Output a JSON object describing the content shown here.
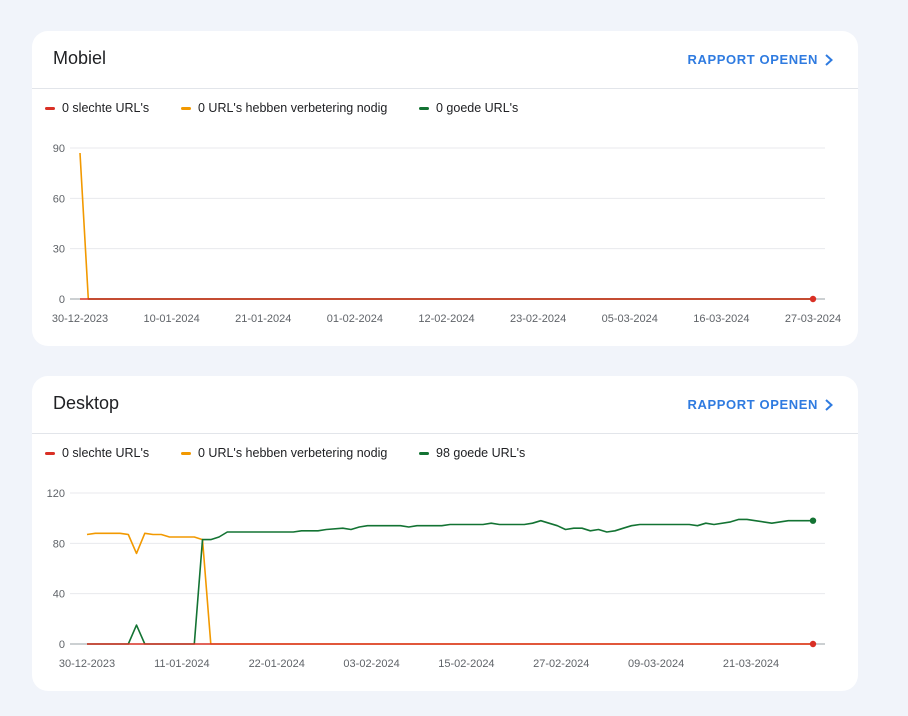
{
  "colors": {
    "poor": "#d93025",
    "needs": "#f29900",
    "good": "#137333",
    "link": "#2f7be0"
  },
  "cards": [
    {
      "title": "Mobiel",
      "link_label": "RAPPORT OPENEN",
      "legend": [
        "0 slechte URL's",
        "0 URL's hebben verbetering nodig",
        "0 goede URL's"
      ],
      "chart_data": {
        "type": "line",
        "x_ticks": [
          "30-12-2023",
          "10-01-2024",
          "21-01-2024",
          "01-02-2024",
          "12-02-2024",
          "23-02-2024",
          "05-03-2024",
          "16-03-2024",
          "27-03-2024"
        ],
        "y_ticks": [
          0,
          30,
          60,
          90
        ],
        "ylim": [
          0,
          90
        ],
        "xlim": [
          0,
          88
        ],
        "grid": true,
        "series": [
          {
            "name": "0 URL's hebben verbetering nodig",
            "color": "#f29900",
            "points": [
              [
                0,
                87
              ],
              [
                1,
                0
              ],
              [
                88,
                0
              ]
            ]
          },
          {
            "name": "0 goede URL's",
            "color": "#137333",
            "points": [
              [
                1,
                0
              ],
              [
                88,
                0
              ]
            ]
          },
          {
            "name": "0 slechte URL's",
            "color": "#d93025",
            "points": [
              [
                0,
                0
              ],
              [
                88,
                0
              ]
            ]
          }
        ]
      }
    },
    {
      "title": "Desktop",
      "link_label": "RAPPORT OPENEN",
      "legend": [
        "0 slechte URL's",
        "0 URL's hebben verbetering nodig",
        "98 goede URL's"
      ],
      "chart_data": {
        "type": "line",
        "x_ticks": [
          "30-12-2023",
          "11-01-2024",
          "22-01-2024",
          "03-02-2024",
          "15-02-2024",
          "27-02-2024",
          "09-03-2024",
          "21-03-2024"
        ],
        "y_ticks": [
          0,
          40,
          80,
          120
        ],
        "ylim": [
          0,
          120
        ],
        "xlim": [
          0,
          88
        ],
        "grid": true,
        "series": [
          {
            "name": "0 URL's hebben verbetering nodig",
            "color": "#f29900",
            "points": [
              [
                0,
                87
              ],
              [
                1,
                88
              ],
              [
                4,
                88
              ],
              [
                5,
                87
              ],
              [
                6,
                72
              ],
              [
                7,
                88
              ],
              [
                8,
                87
              ],
              [
                9,
                87
              ],
              [
                10,
                85
              ],
              [
                11,
                85
              ],
              [
                12,
                85
              ],
              [
                13,
                85
              ],
              [
                14,
                83
              ],
              [
                15,
                0
              ],
              [
                88,
                0
              ]
            ]
          },
          {
            "name": "98 goede URL's",
            "color": "#137333",
            "points": [
              [
                0,
                0
              ],
              [
                5,
                0
              ],
              [
                6,
                15
              ],
              [
                7,
                0
              ],
              [
                13,
                0
              ],
              [
                14,
                83
              ],
              [
                15,
                83
              ],
              [
                16,
                85
              ],
              [
                17,
                89
              ],
              [
                20,
                89
              ],
              [
                25,
                89
              ],
              [
                26,
                90
              ],
              [
                28,
                90
              ],
              [
                29,
                91
              ],
              [
                31,
                92
              ],
              [
                32,
                91
              ],
              [
                33,
                93
              ],
              [
                34,
                94
              ],
              [
                38,
                94
              ],
              [
                39,
                93
              ],
              [
                40,
                94
              ],
              [
                43,
                94
              ],
              [
                44,
                95
              ],
              [
                48,
                95
              ],
              [
                49,
                96
              ],
              [
                50,
                95
              ],
              [
                53,
                95
              ],
              [
                54,
                96
              ],
              [
                55,
                98
              ],
              [
                56,
                96
              ],
              [
                57,
                94
              ],
              [
                58,
                91
              ],
              [
                59,
                92
              ],
              [
                60,
                92
              ],
              [
                61,
                90
              ],
              [
                62,
                91
              ],
              [
                63,
                89
              ],
              [
                64,
                90
              ],
              [
                65,
                92
              ],
              [
                66,
                94
              ],
              [
                67,
                95
              ],
              [
                73,
                95
              ],
              [
                74,
                94
              ],
              [
                75,
                96
              ],
              [
                76,
                95
              ],
              [
                78,
                97
              ],
              [
                79,
                99
              ],
              [
                80,
                99
              ],
              [
                81,
                98
              ],
              [
                82,
                97
              ],
              [
                83,
                96
              ],
              [
                84,
                97
              ],
              [
                85,
                98
              ],
              [
                87,
                98
              ],
              [
                88,
                98
              ]
            ]
          },
          {
            "name": "0 slechte URL's",
            "color": "#d93025",
            "points": [
              [
                0,
                0
              ],
              [
                88,
                0
              ]
            ]
          }
        ]
      }
    }
  ]
}
